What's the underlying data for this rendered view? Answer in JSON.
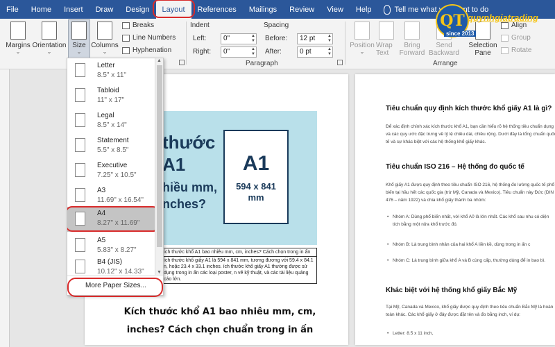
{
  "tabs": [
    "File",
    "Home",
    "Insert",
    "Draw",
    "Design",
    "Layout",
    "References",
    "Mailings",
    "Review",
    "View",
    "Help"
  ],
  "tell_me": "Tell me what you want to do",
  "logo": {
    "letters": "QT",
    "brand": "quynhgiatrading",
    "since": "since 2013"
  },
  "ribbon": {
    "margins": "Margins",
    "orientation": "Orientation",
    "size": "Size",
    "columns": "Columns",
    "breaks": "Breaks",
    "line_numbers": "Line Numbers",
    "hyphenation": "Hyphenation",
    "indent_title": "Indent",
    "left_label": "Left:",
    "right_label": "Right:",
    "left_value": "0\"",
    "right_value": "0\"",
    "spacing_title": "Spacing",
    "before_label": "Before:",
    "after_label": "After:",
    "before_value": "12 pt",
    "after_value": "0 pt",
    "paragraph_group": "Paragraph",
    "position": "Position",
    "wrap_text": "Wrap Text",
    "bring_forward": "Bring Forward",
    "send_backward": "Send Backward",
    "selection_pane": "Selection Pane",
    "align": "Align",
    "group": "Group",
    "rotate": "Rotate",
    "arrange_group": "Arrange"
  },
  "size_menu": {
    "items": [
      {
        "name": "Letter",
        "dims": "8.5\" x 11\""
      },
      {
        "name": "Tabloid",
        "dims": "11\" x 17\""
      },
      {
        "name": "Legal",
        "dims": "8.5\" x 14\""
      },
      {
        "name": "Statement",
        "dims": "5.5\" x 8.5\""
      },
      {
        "name": "Executive",
        "dims": "7.25\" x 10.5\""
      },
      {
        "name": "A3",
        "dims": "11.69\" x 16.54\""
      },
      {
        "name": "A4",
        "dims": "8.27\" x 11.69\""
      },
      {
        "name": "A5",
        "dims": "5.83\" x 8.27\""
      },
      {
        "name": "B4 (JIS)",
        "dims": "10.12\" x 14.33\""
      }
    ],
    "selected": "A4",
    "more": "More Paper Sizes..."
  },
  "page1": {
    "banner_lines": [
      "thước",
      "A1",
      "hiều mm,",
      "nches?"
    ],
    "card_title": "A1",
    "card_dims": "594 x 841",
    "card_unit": "mm",
    "table_row1": "ích thước khổ A1 bao nhiêu mm, cm, inches? Cách chọn trong in ấn",
    "table_row2": "ích thước khổ giấy A1 là 594 x 841 mm, tương đương với 59.4 x 84.1 n, hoặc 23.4 x 33.1 inches. ích thước khổ giấy A1 thường được sử dụng trong in ấn các loại poster, n vẽ kỹ thuật, và các tài liệu quảng cáo lớn.",
    "caption": "Kích thước khổ A1 bao nhiêu mm, cm, inches? Cách chọn chuẩn trong in ấn"
  },
  "page2": {
    "heading1": "Tiêu chuẩn quy định kích thước khổ giấy A1 là gì?",
    "para1": "Để xác định chính xác kích thước khổ A1, bạn cần hiểu rõ hệ thống tiêu chuẩn dụng và các quy ước đặc trưng về tỷ lệ chiều dài, chiều rộng. Dưới đây là tổng chuẩn quốc tế và sự khác biệt với các hệ thống khổ giấy khác.",
    "heading2": "Tiêu chuẩn ISO 216 – Hệ thống đo quốc tế",
    "para2": "Khổ giấy A1 được quy định theo tiêu chuẩn ISO 216, hệ thống đo lường quốc tế phổ biến tại hầu hết các quốc gia (trừ Mỹ, Canada và Mexico). Tiêu chuẩn này Đức (DIN 476 – năm 1922) và chia khổ giấy thành ba nhóm:",
    "bullets": [
      "Nhóm A: Dùng phổ biến nhất, với khổ A0 là lớn nhất. Các khổ sau nhu có diện tích bằng một nửa khổ trước đó.",
      "Nhóm B: Là trung bình nhân của hai khổ A liền kề, dùng trong in ấn c",
      "Nhóm C: Là trung bình giữa khổ A và B cùng cấp, thường dùng để in bao bì."
    ],
    "heading3": "Khác biệt với hệ thống khổ giấy Bắc Mỹ",
    "para3": "Tại Mỹ, Canada và Mexico, khổ giấy được quy định theo tiêu chuẩn Bắc Mỹ là hoàn toàn khác. Các khổ giấy ở đây được đặt tên và đo bằng inch, ví dụ:",
    "bullet_last": "Letter: 8.5 x 11 inch,"
  }
}
